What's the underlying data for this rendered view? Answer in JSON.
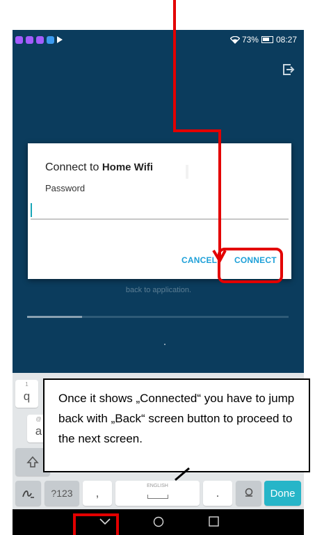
{
  "status_bar": {
    "battery": "73%",
    "time": "08:27",
    "app_icons": [
      "#a35cff",
      "#a35cff",
      "#a35cff",
      "#3d9bf0",
      "#ffffff"
    ]
  },
  "dialog": {
    "title_prefix": "Connect to",
    "network_name": "Home Wifi",
    "password_label": "Password",
    "password_value": "",
    "cancel_label": "CANCEL",
    "connect_label": "CONNECT"
  },
  "background_screen": {
    "hint_text": "back to application.",
    "progress_fraction": 0.21
  },
  "keyboard": {
    "row1_visible_key": "q",
    "row1_hint": "1",
    "row2_visible_key": "a",
    "row2_hint": "@",
    "symbols_key": "?123",
    "comma_key": ",",
    "period_key": ".",
    "space_hint": "ENGLISH",
    "done_label": "Done"
  },
  "callout": {
    "text": "Once it shows „Connected“ you have to jump back with „Back“ screen button to proceed to the next screen."
  },
  "colors": {
    "app_background": "#0b3c5d",
    "accent": "#1ea0d8",
    "annotation_red": "#e30000",
    "done_key": "#26b5c8"
  }
}
